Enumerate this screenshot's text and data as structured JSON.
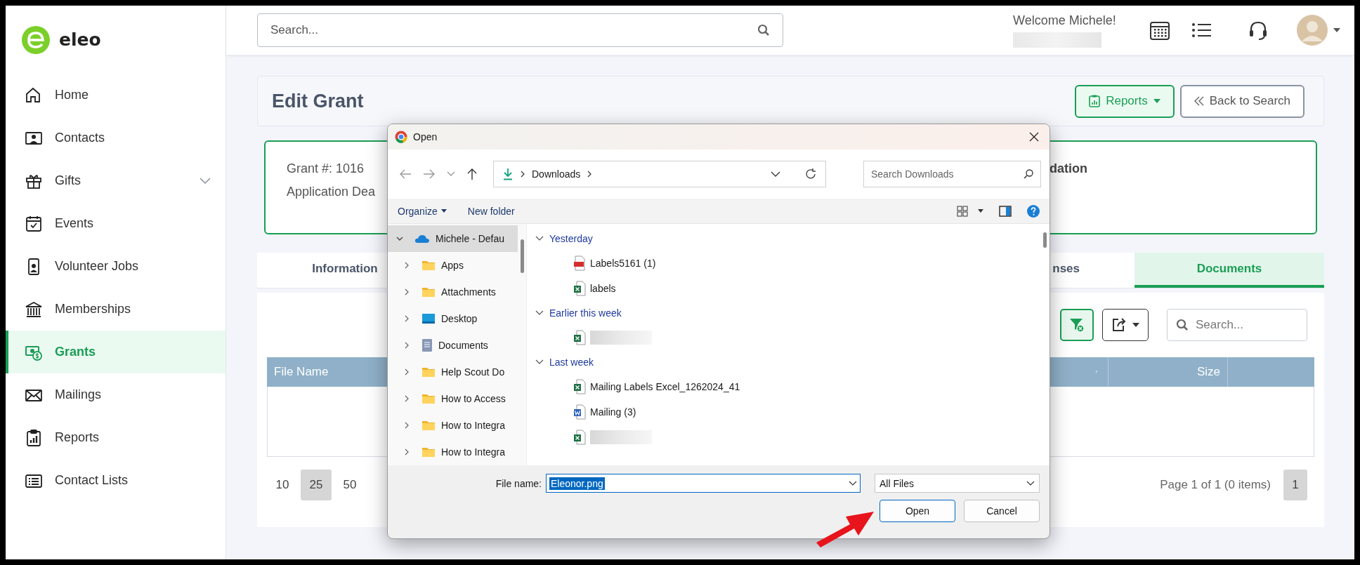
{
  "sidebar": {
    "logo": "eleo",
    "items": [
      {
        "label": "Home",
        "selected": false
      },
      {
        "label": "Contacts",
        "selected": false
      },
      {
        "label": "Gifts",
        "selected": false,
        "expanded": false
      },
      {
        "label": "Events",
        "selected": false
      },
      {
        "label": "Volunteer Jobs",
        "selected": false
      },
      {
        "label": "Memberships",
        "selected": false
      },
      {
        "label": "Grants",
        "selected": true
      },
      {
        "label": "Mailings",
        "selected": false
      },
      {
        "label": "Reports",
        "selected": false
      },
      {
        "label": "Contact Lists",
        "selected": false
      }
    ]
  },
  "header": {
    "search": {
      "placeholder": "Search..."
    },
    "welcome": "Welcome Michele!"
  },
  "page": {
    "title": "Edit Grant",
    "buttons": [
      {
        "label": "Reports",
        "kind": "menu"
      },
      {
        "label": "Back to Search",
        "kind": "back"
      }
    ]
  },
  "summary": {
    "left": [
      "Grant #: 1016",
      "Application Dea"
    ],
    "right": "dation"
  },
  "tabs": [
    {
      "label": "Information",
      "selected": false
    },
    {
      "label": "nses",
      "selected": false
    },
    {
      "label": "Documents",
      "selected": true
    }
  ],
  "grid": {
    "search": {
      "placeholder": "Search..."
    },
    "columns": [
      "File Name",
      "Size"
    ],
    "page_sizes": [
      {
        "label": "10",
        "selected": false
      },
      {
        "label": "25",
        "selected": true
      },
      {
        "label": "50",
        "selected": false
      }
    ],
    "pager_info": "Page 1 of 1 (0 items)",
    "pages": [
      {
        "label": "1",
        "selected": true
      }
    ]
  },
  "dialog": {
    "title": "Open",
    "address": "Downloads",
    "search": {
      "placeholder": "Search Downloads"
    },
    "toolbar": [
      "Organize",
      "New folder"
    ],
    "tree": [
      {
        "label": "Michele - Defau",
        "kind": "cloud",
        "expanded": true,
        "selected": true,
        "children": [
          {
            "label": "Apps",
            "kind": "folder",
            "expanded": false,
            "selected": false
          },
          {
            "label": "Attachments",
            "kind": "folder",
            "expanded": false,
            "selected": false
          },
          {
            "label": "Desktop",
            "kind": "desktop",
            "expanded": false,
            "selected": false
          },
          {
            "label": "Documents",
            "kind": "documents",
            "expanded": false,
            "selected": false
          },
          {
            "label": "Help Scout Do",
            "kind": "folder",
            "expanded": false,
            "selected": false
          },
          {
            "label": "How to Access",
            "kind": "folder",
            "expanded": false,
            "selected": false
          },
          {
            "label": "How to Integra",
            "kind": "folder",
            "expanded": false,
            "selected": false
          },
          {
            "label": "How to Integra",
            "kind": "folder",
            "expanded": false,
            "selected": false
          }
        ]
      }
    ],
    "groups": [
      {
        "label": "Yesterday",
        "expanded": true,
        "files": [
          {
            "name": "Labels5161 (1)",
            "kind": "pdf"
          },
          {
            "name": "labels",
            "kind": "excel"
          }
        ]
      },
      {
        "label": "Earlier this week",
        "expanded": true,
        "files": [
          {
            "kind": "excel"
          }
        ]
      },
      {
        "label": "Last week",
        "expanded": true,
        "files": [
          {
            "name": "Mailing Labels Excel_1262024_41",
            "kind": "excel"
          },
          {
            "name": "Mailing (3)",
            "kind": "word"
          },
          {
            "kind": "excel"
          }
        ]
      }
    ],
    "file_name": {
      "label": "File name:",
      "value": "Eleonor.png"
    },
    "filter": "All Files",
    "buttons": [
      "Open",
      "Cancel"
    ]
  }
}
